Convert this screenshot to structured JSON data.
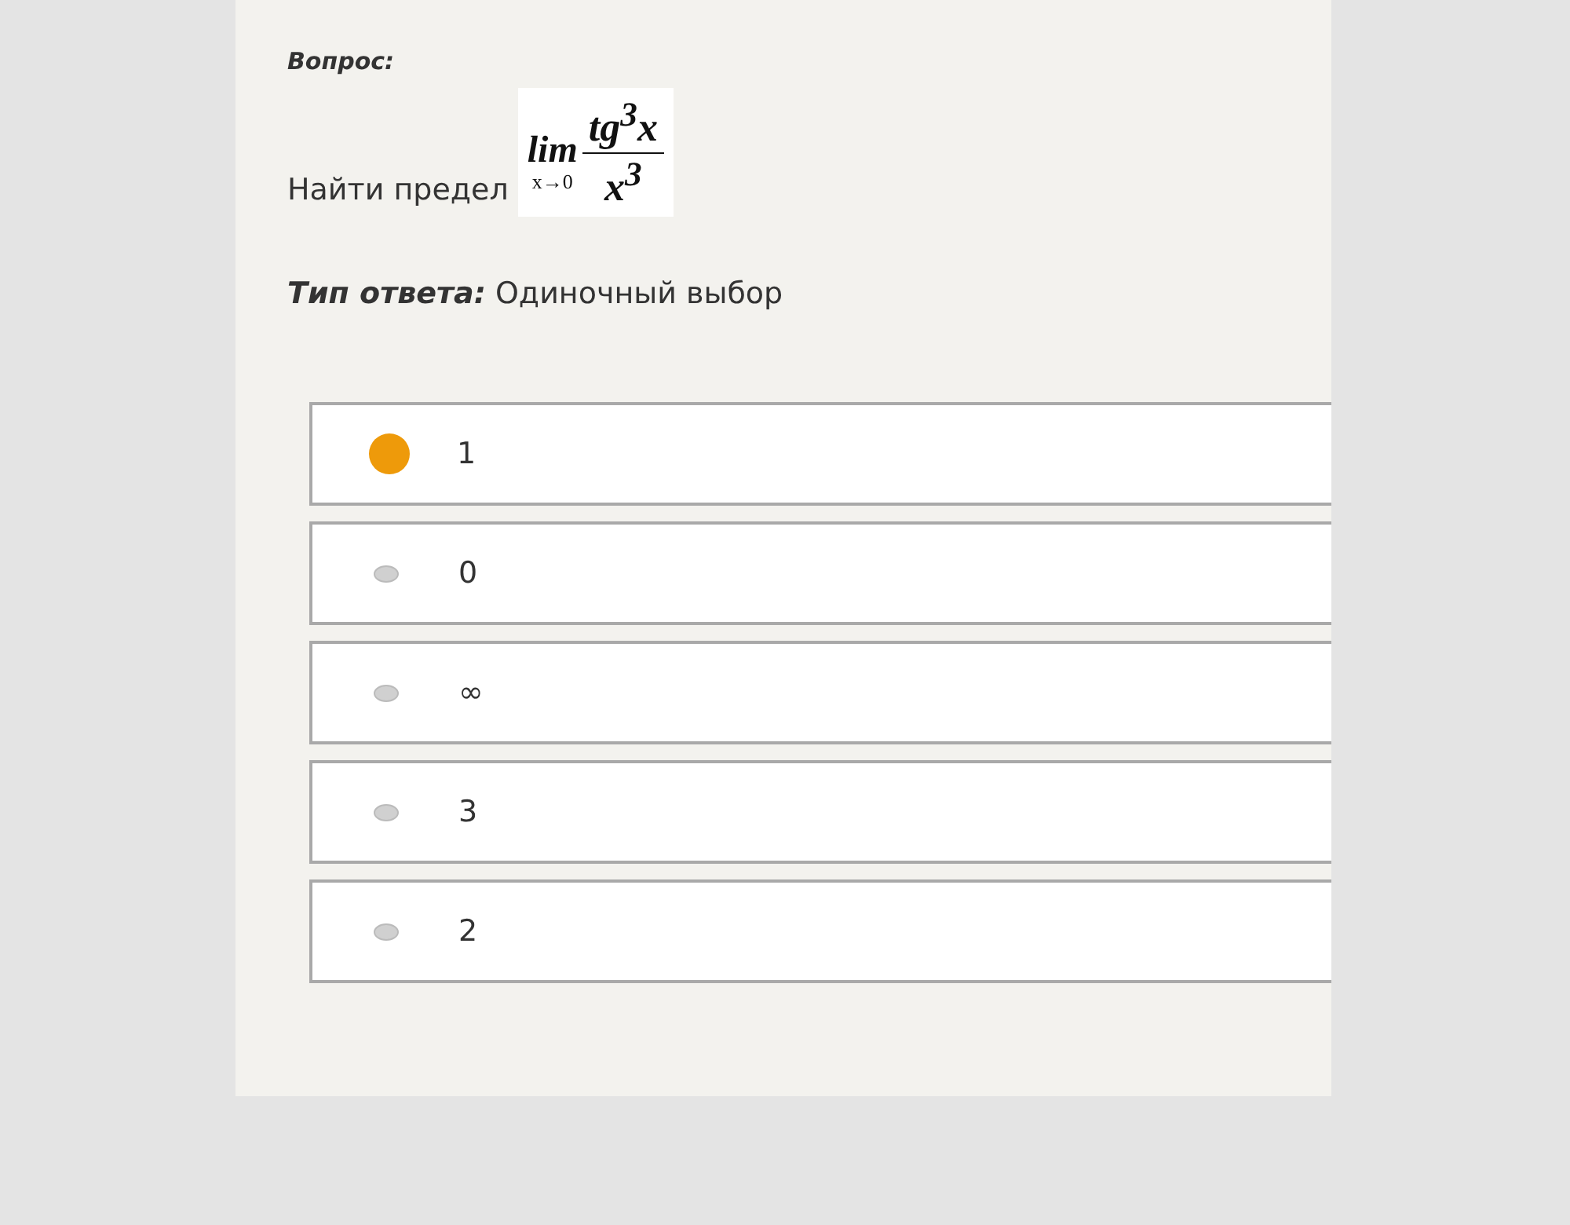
{
  "question": {
    "label": "Вопрос:",
    "text": "Найти предел",
    "formula": {
      "operator": "lim",
      "subscript": "x→0",
      "numerator": "tg$^{3}$x",
      "denominator": "x$^{3}$"
    }
  },
  "answer_type": {
    "label": "Тип ответа:",
    "value": "Одиночный выбор"
  },
  "options": [
    {
      "label": "1",
      "selected": true
    },
    {
      "label": "0",
      "selected": false
    },
    {
      "label": "∞",
      "selected": false
    },
    {
      "label": "3",
      "selected": false
    },
    {
      "label": "2",
      "selected": false
    }
  ]
}
